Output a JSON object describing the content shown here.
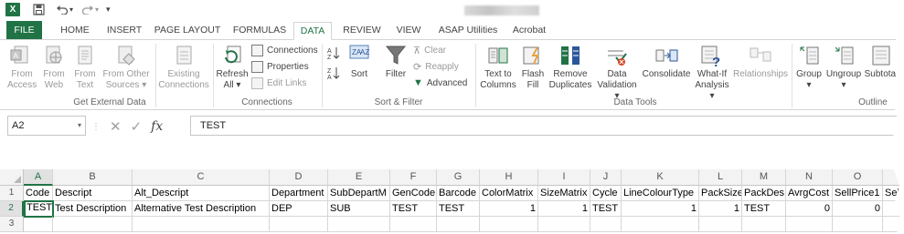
{
  "titlebar": {
    "app_icon": "excel-logo",
    "app_letter": "X",
    "qa_icons": [
      "save-icon",
      "undo-icon",
      "redo-icon",
      "customize-icon"
    ]
  },
  "tabs": [
    {
      "label": "FILE"
    },
    {
      "label": "HOME"
    },
    {
      "label": "INSERT"
    },
    {
      "label": "PAGE LAYOUT"
    },
    {
      "label": "FORMULAS"
    },
    {
      "label": "DATA"
    },
    {
      "label": "REVIEW"
    },
    {
      "label": "VIEW"
    },
    {
      "label": "ASAP Utilities"
    },
    {
      "label": "Acrobat"
    }
  ],
  "ribbon": {
    "get_external": {
      "from_access": [
        "From",
        "Access"
      ],
      "from_web": [
        "From",
        "Web"
      ],
      "from_text": [
        "From",
        "Text"
      ],
      "from_other": [
        "From Other",
        "Sources ▾"
      ],
      "existing": [
        "Existing",
        "Connections"
      ],
      "label": "Get External Data"
    },
    "connections": {
      "refresh": [
        "Refresh",
        "All ▾"
      ],
      "connections": "Connections",
      "properties": "Properties",
      "edit_links": "Edit Links",
      "label": "Connections"
    },
    "sort_filter": {
      "sort": "Sort",
      "filter": "Filter",
      "clear": "Clear",
      "reapply": "Reapply",
      "advanced": "Advanced",
      "label": "Sort & Filter"
    },
    "data_tools": {
      "text_to_columns": [
        "Text to",
        "Columns"
      ],
      "flash_fill": [
        "Flash",
        "Fill"
      ],
      "remove_duplicates": [
        "Remove",
        "Duplicates"
      ],
      "data_validation": [
        "Data",
        "Validation ▾"
      ],
      "consolidate": "Consolidate",
      "what_if": [
        "What-If",
        "Analysis ▾"
      ],
      "relationships": "Relationships",
      "label": "Data Tools"
    },
    "outline": {
      "group": [
        "Group",
        "▾"
      ],
      "ungroup": [
        "Ungroup",
        "▾"
      ],
      "subtotal": "Subtotal",
      "label": "Outline"
    }
  },
  "formula_bar": {
    "name_box": "A2",
    "formula": "TEST"
  },
  "grid": {
    "columns": [
      "A",
      "B",
      "C",
      "D",
      "E",
      "F",
      "G",
      "H",
      "I",
      "J",
      "K",
      "L",
      "M",
      "N",
      "O"
    ],
    "rows": [
      "1",
      "2",
      "3"
    ],
    "header_row": [
      "Code",
      "Descript",
      "Alt_Descript",
      "Department",
      "SubDepartM",
      "GenCode",
      "Barcode",
      "ColorMatrix",
      "SizeMatrix",
      "Cycle",
      "LineColourType",
      "PackSize",
      "PackDes",
      "AvrgCost",
      "SellPrice1",
      "Sel"
    ],
    "data_row": [
      "TEST",
      "Test Description",
      "Alternative Test Description",
      "DEP",
      "SUB",
      "TEST",
      "TEST",
      "1",
      "1",
      "TEST",
      "1",
      "1",
      "TEST",
      "0",
      "0",
      ""
    ]
  }
}
